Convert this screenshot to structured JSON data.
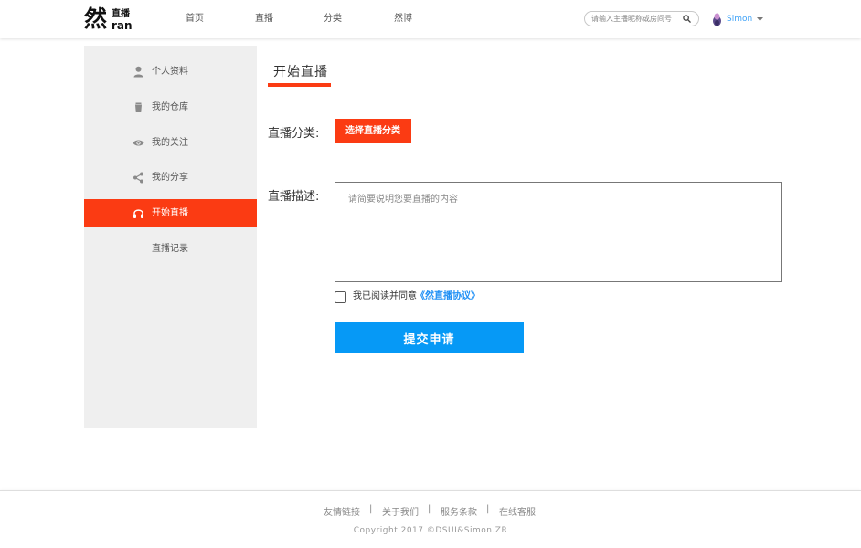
{
  "brand": {
    "logo_big": "然",
    "logo_top": "直播",
    "logo_bottom": "ran"
  },
  "nav": {
    "items": [
      {
        "label": "首页"
      },
      {
        "label": "直播"
      },
      {
        "label": "分类"
      },
      {
        "label": "然博"
      }
    ]
  },
  "search": {
    "placeholder": "请输入主播昵称或房间号",
    "icon": "search-icon"
  },
  "user": {
    "name": "Simon",
    "avatar_icon": "avatar-icon",
    "dropdown_icon": "caret-down-icon"
  },
  "sidebar": {
    "items": [
      {
        "label": "个人资料",
        "icon": "person-icon"
      },
      {
        "label": "我的仓库",
        "icon": "trash-can-icon"
      },
      {
        "label": "我的关注",
        "icon": "eye-icon"
      },
      {
        "label": "我的分享",
        "icon": "share-icon"
      },
      {
        "label": "开始直播",
        "icon": "headphones-icon",
        "active": true
      },
      {
        "label": "直播记录",
        "icon": ""
      }
    ]
  },
  "main": {
    "title": "开始直播",
    "category_label": "直播分类:",
    "category_button": "选择直播分类",
    "description_label": "直播描述:",
    "description_placeholder": "请简要说明您要直播的内容",
    "agree_text": "我已阅读并同意",
    "agree_link": "《然直播协议》",
    "submit_label": "提交申请"
  },
  "footer": {
    "links": [
      {
        "label": "友情链接"
      },
      {
        "label": "关于我们"
      },
      {
        "label": "服务条款"
      },
      {
        "label": "在线客服"
      }
    ],
    "separator": "|",
    "copyright": "Copyright 2017 ©DSUI&Simon.ZR"
  },
  "colors": {
    "accent": "#fb3b13",
    "primary_blue": "#0699f6",
    "link_blue": "#1e8ff5",
    "sidebar_bg": "#efefef"
  }
}
